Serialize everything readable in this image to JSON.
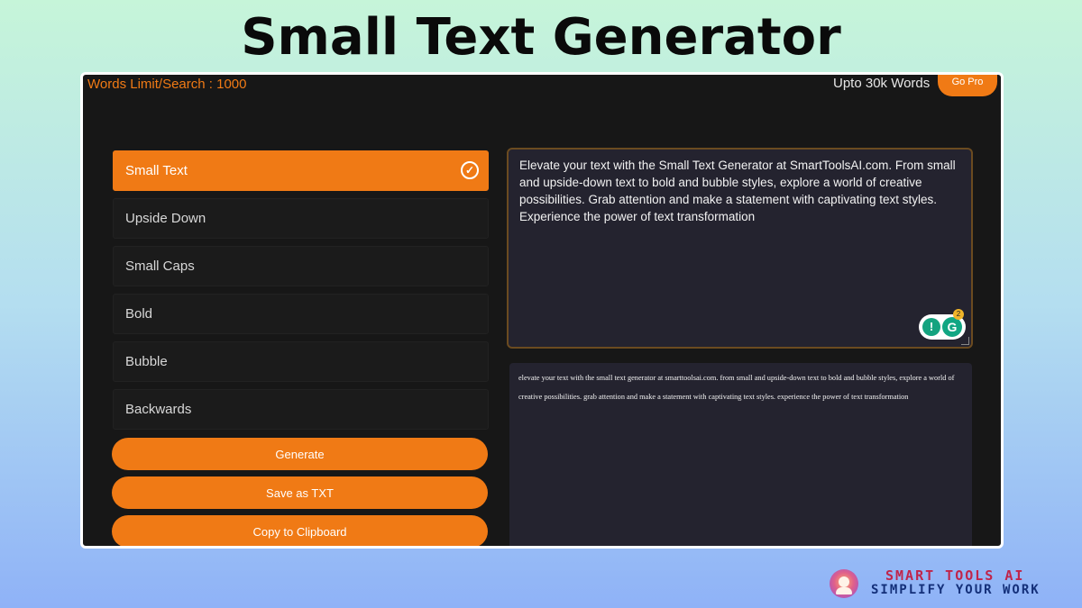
{
  "banner": {
    "title": "Small Text Generator"
  },
  "header": {
    "words_limit": "Words Limit/Search : 1000",
    "upto": "Upto 30k Words",
    "go_pro": "Go Pro"
  },
  "styles": [
    {
      "label": "Small Text",
      "selected": true
    },
    {
      "label": "Upside Down",
      "selected": false
    },
    {
      "label": "Small Caps",
      "selected": false
    },
    {
      "label": "Bold",
      "selected": false
    },
    {
      "label": "Bubble",
      "selected": false
    },
    {
      "label": "Backwards",
      "selected": false
    }
  ],
  "actions": {
    "generate": "Generate",
    "save_txt": "Save as TXT",
    "copy": "Copy to Clipboard"
  },
  "input": {
    "text": "Elevate your text with the Small Text Generator at SmartToolsAI.com. From small and upside-down text to bold and bubble styles, explore a world of creative possibilities. Grab attention and make a statement with captivating text styles. Experience the power of text transformation",
    "grammar_count": "2"
  },
  "output": {
    "text": "elevate your text with the small text generator at smarttoolsai.com. from small and upside-down text to bold and bubble styles, explore a world of creative possibilities. grab attention and make a statement with captivating text styles. experience the power of text transformation"
  },
  "brand": {
    "name": "SMART TOOLS AI",
    "tagline": "SIMPLIFY YOUR WORK"
  },
  "colors": {
    "accent": "#f07a15",
    "panel": "#171717",
    "textarea": "#24232f"
  },
  "icons": [
    "check-circle-icon",
    "lightbulb-icon",
    "grammarly-icon",
    "resize-grip-icon",
    "brand-logo-icon"
  ]
}
